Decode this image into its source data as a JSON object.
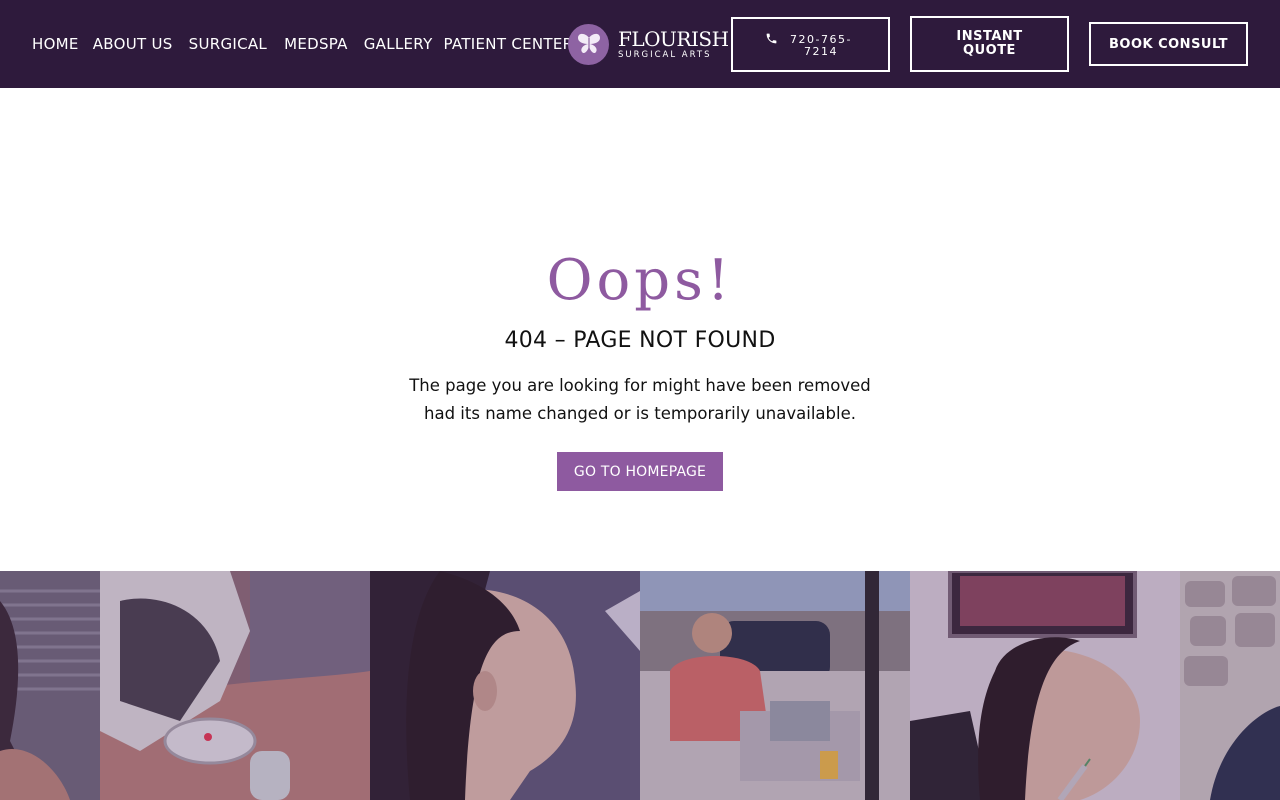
{
  "nav": {
    "items": [
      "HOME",
      "ABOUT US",
      "SURGICAL",
      "MEDSPA",
      "GALLERY",
      "PATIENT CENTER"
    ]
  },
  "logo": {
    "name": "FLOURISH",
    "subtitle": "SURGICAL ARTS",
    "icon": "butterfly-icon"
  },
  "header_buttons": {
    "phone": "720-765-7214",
    "phone_icon": "phone-icon",
    "quote": "INSTANT QUOTE",
    "consult": "BOOK CONSULT"
  },
  "error": {
    "heading": "Oops!",
    "title": "404 – PAGE NOT FOUND",
    "message": "The page you are looking for might have been removed had its name changed or is temporarily unavailable.",
    "button": "GO TO HOMEPAGE"
  },
  "colors": {
    "header_bg": "#2e1a3c",
    "accent": "#8e5aa0",
    "logo_circle": "#8e63a3"
  }
}
